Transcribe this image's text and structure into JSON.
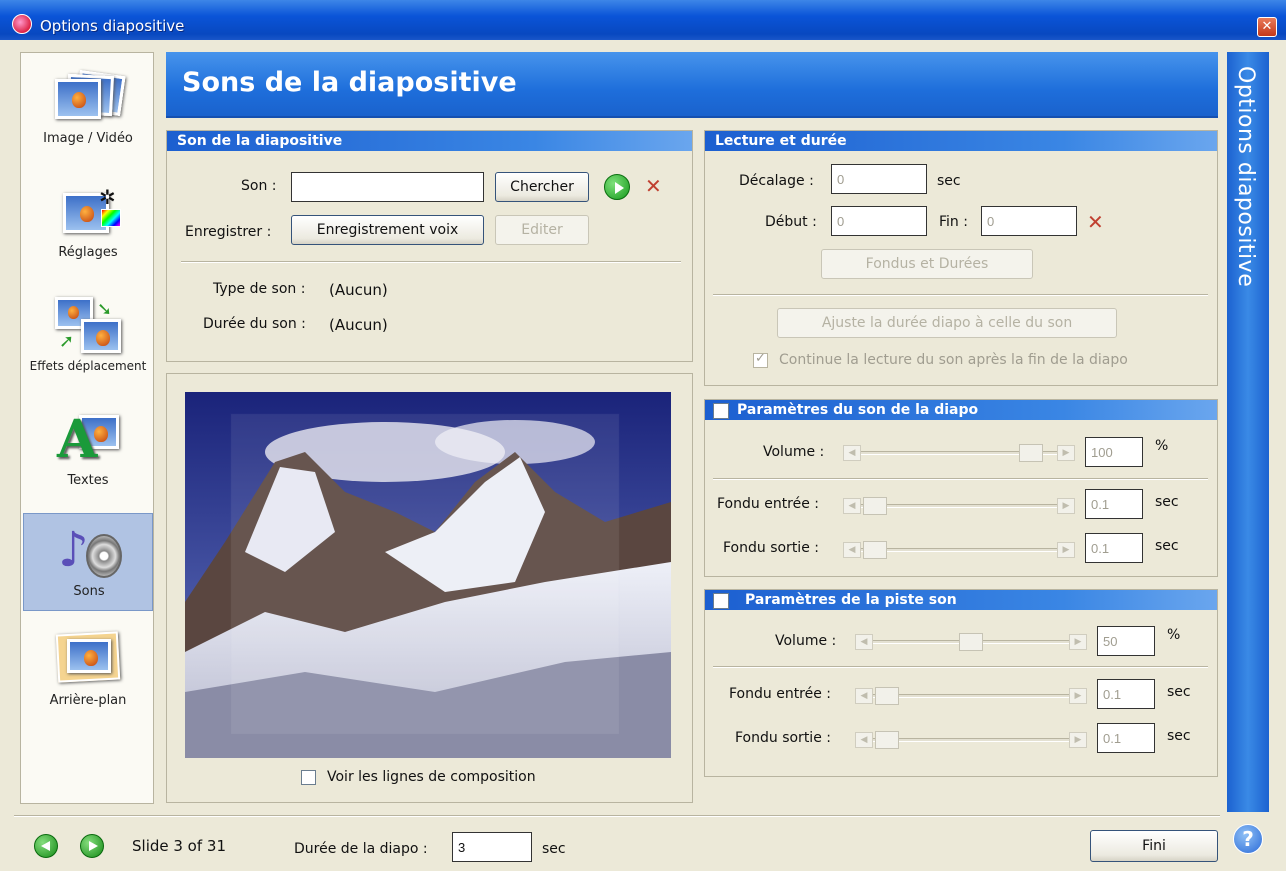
{
  "window": {
    "title": "Options diapositive",
    "close": "✕"
  },
  "sidebar": {
    "items": [
      {
        "label": "Image / Vidéo"
      },
      {
        "label": "Réglages"
      },
      {
        "label": "Effets déplacement"
      },
      {
        "label": "Textes"
      },
      {
        "label": "Sons"
      },
      {
        "label": "Arrière-plan"
      }
    ],
    "active": "Sons"
  },
  "header": {
    "title": "Sons de la diapositive"
  },
  "vertical_title": "Options diapositive",
  "son_panel": {
    "title": "Son de la diapositive",
    "son_label": "Son :",
    "son_value": "",
    "chercher": "Chercher",
    "enregistrer_label": "Enregistrer :",
    "enregistrement_voix": "Enregistrement voix",
    "editer": "Editer",
    "type_label": "Type de son :",
    "type_value": "(Aucun)",
    "duree_label": "Durée du son :",
    "duree_value": "(Aucun)"
  },
  "preview": {
    "composition_label": "Voir les lignes de composition",
    "composition_checked": false
  },
  "lecture_panel": {
    "title": "Lecture et durée",
    "decalage_label": "Décalage :",
    "decalage_value": "0",
    "sec1": "sec",
    "debut_label": "Début :",
    "debut_value": "0",
    "fin_label": "Fin :",
    "fin_value": "0",
    "fondus_btn": "Fondus et Durées",
    "ajuste_btn": "Ajuste la durée diapo à celle du son",
    "continue_label": "Continue la lecture du son après la fin de la diapo",
    "continue_checked": true
  },
  "param_diapo": {
    "title": "Paramètres du son de la diapo",
    "volume_label": "Volume :",
    "volume_value": "100",
    "pct": "%",
    "fondu_entree_label": "Fondu entrée :",
    "fondu_entree_value": "0.1",
    "fondu_sortie_label": "Fondu sortie :",
    "fondu_sortie_value": "0.1",
    "sec": "sec"
  },
  "param_piste": {
    "title": "Paramètres de la piste son",
    "volume_label": "Volume :",
    "volume_value": "50",
    "pct": "%",
    "fondu_entree_label": "Fondu entrée :",
    "fondu_entree_value": "0.1",
    "fondu_sortie_label": "Fondu sortie :",
    "fondu_sortie_value": "0.1",
    "sec": "sec"
  },
  "footer": {
    "slide_text": "Slide 3 of 31",
    "duree_label": "Durée de la diapo :",
    "duree_value": "3",
    "sec": "sec",
    "fini": "Fini",
    "help": "?"
  },
  "colors": {
    "accent": "#1e6edb",
    "background": "#ece9d8",
    "titlebar": "#0a54d8"
  }
}
